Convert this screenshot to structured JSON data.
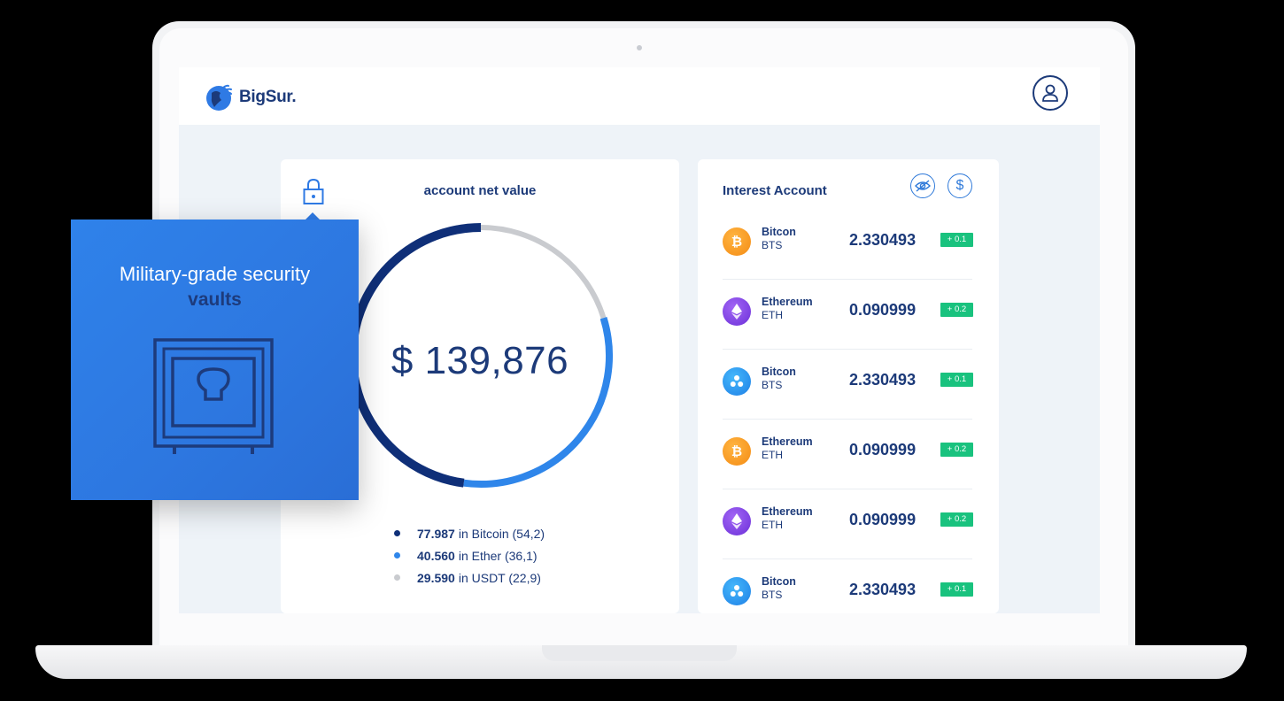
{
  "app": {
    "brand": "BigSur."
  },
  "net_value_card": {
    "title": "account net value",
    "value": "$ 139,876",
    "legend": [
      {
        "amount": "77.987",
        "text": "in Bitcoin (54,2)",
        "color": "#0f2f78"
      },
      {
        "amount": "40.560",
        "text": "in Ether (36,1)",
        "color": "#2f86ea"
      },
      {
        "amount": "29.590",
        "text": "in USDT (22,9)",
        "color": "#c9cbcf"
      }
    ]
  },
  "chart_data": {
    "type": "pie",
    "categories": [
      "Bitcoin",
      "Ether",
      "USDT"
    ],
    "values": [
      54.2,
      36.1,
      22.9
    ],
    "colors": [
      "#0f2f78",
      "#2f86ea",
      "#c9cbcf"
    ]
  },
  "interest_account": {
    "title": "Interest Account",
    "rows": [
      {
        "name": "Bitcon",
        "symbol": "BTS",
        "amount": "2.330493",
        "change": "+ 0.1",
        "icon": "btc"
      },
      {
        "name": "Ethereum",
        "symbol": "ETH",
        "amount": "0.090999",
        "change": "+ 0.2",
        "icon": "eth"
      },
      {
        "name": "Bitcon",
        "symbol": "BTS",
        "amount": "2.330493",
        "change": "+ 0.1",
        "icon": "xrp"
      },
      {
        "name": "Ethereum",
        "symbol": "ETH",
        "amount": "0.090999",
        "change": "+ 0.2",
        "icon": "btc"
      },
      {
        "name": "Ethereum",
        "symbol": "ETH",
        "amount": "0.090999",
        "change": "+ 0.2",
        "icon": "eth"
      },
      {
        "name": "Bitcon",
        "symbol": "BTS",
        "amount": "2.330493",
        "change": "+ 0.1",
        "icon": "xrp"
      }
    ],
    "dollar_symbol": "$"
  },
  "promo": {
    "line1": "Military-grade security",
    "line2": "vaults"
  },
  "colors": {
    "primary_navy": "#1c3a79",
    "accent_blue": "#2f7ae4",
    "positive_green": "#19c27e"
  }
}
